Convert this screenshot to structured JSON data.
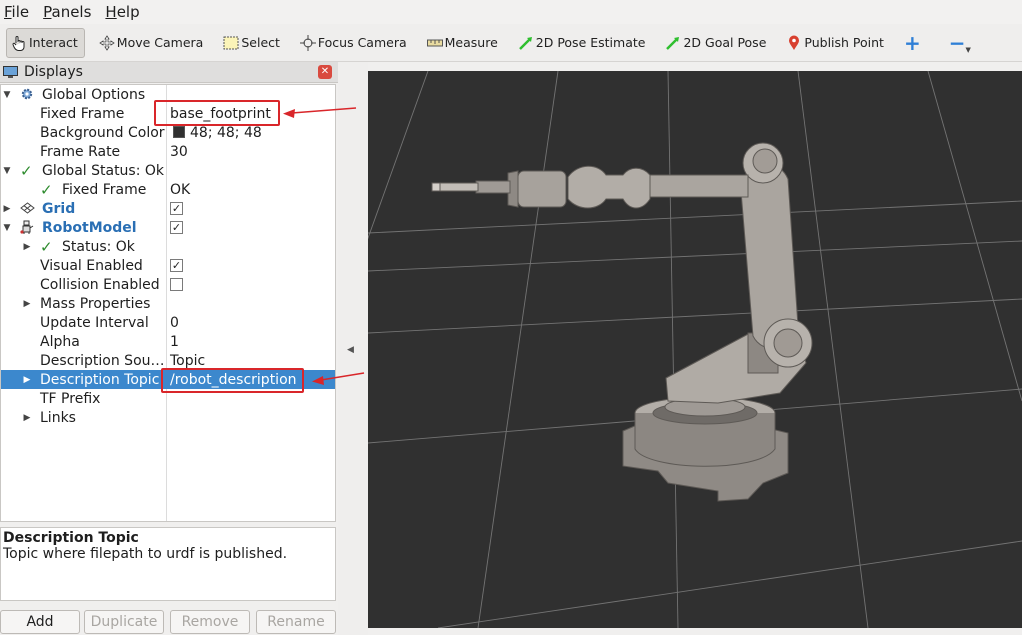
{
  "menu": [
    {
      "label": "File",
      "u": "F",
      "rest": "ile"
    },
    {
      "label": "Panels",
      "u": "P",
      "rest": "anels"
    },
    {
      "label": "Help",
      "u": "H",
      "rest": "elp"
    }
  ],
  "toolbar": {
    "interact": "Interact",
    "move_camera": "Move Camera",
    "select": "Select",
    "focus_camera": "Focus Camera",
    "measure": "Measure",
    "pose_estimate": "2D Pose Estimate",
    "goal_pose": "2D Goal Pose",
    "publish_point": "Publish Point",
    "plus": "+",
    "minus": "−"
  },
  "displays": {
    "title": "Displays",
    "rows": {
      "global_options": "Global Options",
      "fixed_frame": "Fixed Frame",
      "fixed_frame_val": "base_footprint",
      "bg_color": "Background Color",
      "bg_color_val": "48; 48; 48",
      "frame_rate": "Frame Rate",
      "frame_rate_val": "30",
      "global_status": "Global Status: Ok",
      "status_fixed_frame": "Fixed Frame",
      "status_fixed_frame_val": "OK",
      "grid": "Grid",
      "robot_model": "RobotModel",
      "status_ok": "Status: Ok",
      "visual_enabled": "Visual Enabled",
      "collision_enabled": "Collision Enabled",
      "mass_properties": "Mass Properties",
      "update_interval": "Update Interval",
      "update_interval_val": "0",
      "alpha": "Alpha",
      "alpha_val": "1",
      "description_source": "Description Sou…",
      "description_source_val": "Topic",
      "description_topic": "Description Topic",
      "description_topic_val": "/robot_description",
      "tf_prefix": "TF Prefix",
      "links": "Links"
    },
    "checks": {
      "grid": true,
      "robot_model": true,
      "visual_enabled": true,
      "collision_enabled": false
    }
  },
  "description": {
    "title": "Description Topic",
    "body": "Topic where filepath to urdf is published."
  },
  "buttons": {
    "add": "Add",
    "duplicate": "Duplicate",
    "remove": "Remove",
    "rename": "Rename"
  },
  "colors": {
    "viewport_bg": "#303030",
    "selection": "#3c88cd",
    "annotation": "#d9262a",
    "robot": "#a6a09a"
  }
}
